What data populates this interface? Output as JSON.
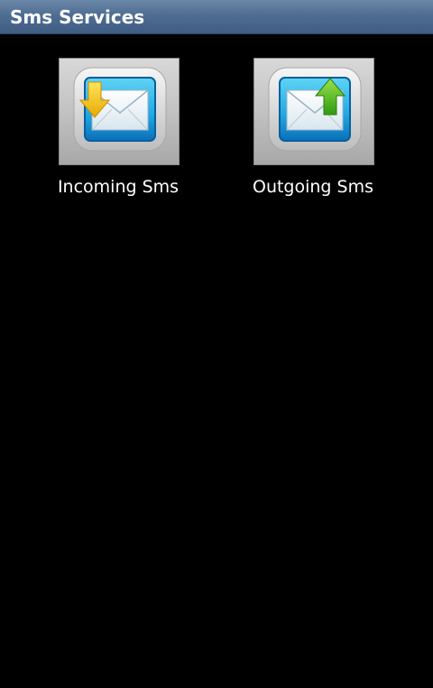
{
  "app": {
    "title": "Sms Services"
  },
  "menu": {
    "items": [
      {
        "label": "Incoming Sms",
        "icon": "incoming-mail-icon",
        "arrow_color": "#f2c200"
      },
      {
        "label": "Outgoing Sms",
        "icon": "outgoing-mail-icon",
        "arrow_color": "#4fb81a"
      }
    ]
  },
  "colors": {
    "titlebar": "#4f6d92",
    "background": "#000000",
    "text": "#ffffff"
  }
}
